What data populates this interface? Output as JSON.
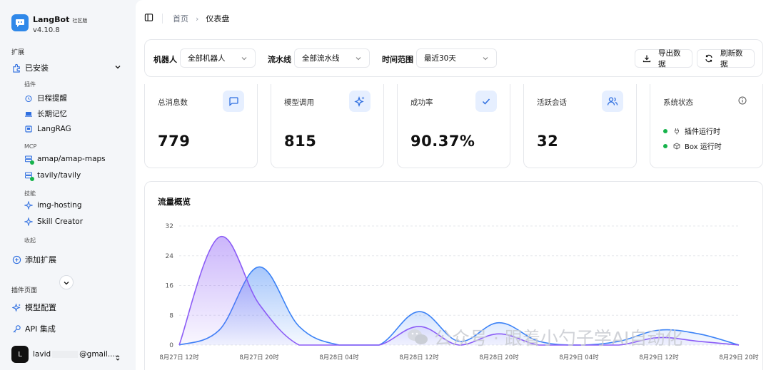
{
  "brand": {
    "name": "LangBot",
    "badge": "社区版",
    "version": "v4.10.8"
  },
  "sidebar": {
    "section_ext": "扩展",
    "installed": "已安装",
    "group_plugins": "插件",
    "plugins": [
      {
        "label": "日程提醒",
        "icon": "alarm-clock-icon"
      },
      {
        "label": "长期记忆",
        "icon": "laptop-icon"
      },
      {
        "label": "LangRAG",
        "icon": "book-icon"
      }
    ],
    "group_mcp": "MCP",
    "mcps": [
      {
        "label": "amap/amap-maps",
        "icon": "server-icon"
      },
      {
        "label": "tavily/tavily",
        "icon": "server-icon"
      }
    ],
    "group_skills": "技能",
    "skills": [
      {
        "label": "img-hosting",
        "icon": "sparkle-icon"
      },
      {
        "label": "Skill Creator",
        "icon": "sparkle-icon"
      }
    ],
    "collapse_label": "收起",
    "add_ext": "添加扩展",
    "section_plugin_pages": "插件页面",
    "model_config": "模型配置",
    "api_integration": "API 集成",
    "user": {
      "avatar_letter": "L",
      "name_prefix": "lavid",
      "name_suffix": "@gmail...."
    }
  },
  "topbar": {
    "crumb_home": "首页",
    "crumb_current": "仪表盘"
  },
  "filters": {
    "bot_label": "机器人",
    "bot_value": "全部机器人",
    "pipeline_label": "流水线",
    "pipeline_value": "全部流水线",
    "range_label": "时间范围",
    "range_value": "最近30天",
    "export_label": "导出数据",
    "refresh_label": "刷新数据"
  },
  "stats": [
    {
      "title": "总消息数",
      "value": "779",
      "icon": "message-square-icon"
    },
    {
      "title": "模型调用",
      "value": "815",
      "icon": "sparkles-icon"
    },
    {
      "title": "成功率",
      "value": "90.37%",
      "icon": "check-icon"
    },
    {
      "title": "活跃会话",
      "value": "32",
      "icon": "users-icon"
    }
  ],
  "system": {
    "title": "系统状态",
    "plugin_runtime": "插件运行时",
    "box_runtime": "Box 运行时"
  },
  "chart_panel": {
    "title": "流量概览"
  },
  "chart_data": {
    "type": "area",
    "x": [
      "8月27日 12时",
      "8月27日 16时",
      "8月27日 20时",
      "8月28日 00时",
      "8月28日 04时",
      "8月28日 08时",
      "8月28日 12时",
      "8月28日 16时",
      "8月28日 20时",
      "8月29日 00时",
      "8月29日 04时",
      "8月29日 08时",
      "8月29日 12时",
      "8月29日 16时",
      "8月29日 20时"
    ],
    "tick_labels": [
      "8月27日 12时",
      "8月27日 20时",
      "8月28日 04时",
      "8月28日 12时",
      "8月28日 20时",
      "8月29日 04时",
      "8月29日 12时",
      "8月29日 20时"
    ],
    "yticks": [
      0,
      8,
      16,
      24,
      32
    ],
    "ylim": [
      0,
      32
    ],
    "series": [
      {
        "color": "#3b82f6",
        "values": [
          0,
          4,
          21,
          5,
          0,
          0,
          9,
          1,
          6,
          1,
          0,
          1,
          4,
          3,
          0
        ]
      },
      {
        "color": "#8b5cf6",
        "values": [
          0,
          29,
          11,
          0,
          0,
          0,
          5,
          0,
          3,
          0,
          0,
          0,
          2,
          1,
          0
        ]
      }
    ],
    "grid": true
  },
  "watermark": {
    "text": "公众号 · 跟着小勺子学AI自动化"
  }
}
